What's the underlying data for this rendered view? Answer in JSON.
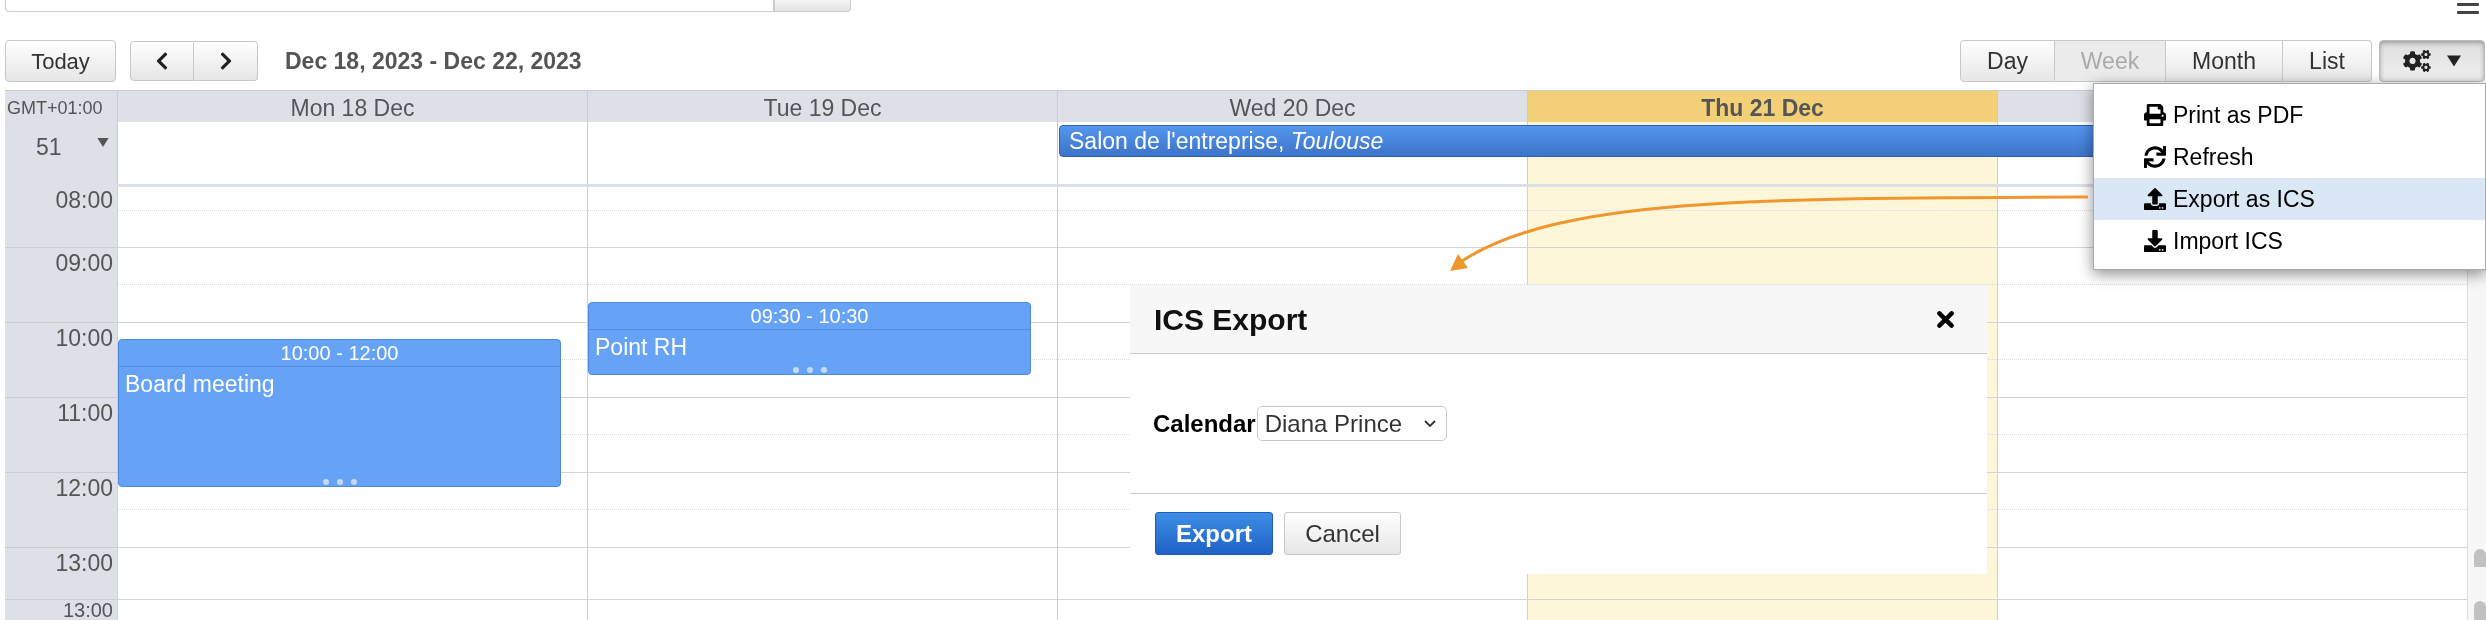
{
  "toolbar": {
    "today_button": "Today",
    "date_range": "Dec 18, 2023 - Dec 22, 2023",
    "views": [
      {
        "label": "Day",
        "selected": false
      },
      {
        "label": "Week",
        "selected": true
      },
      {
        "label": "Month",
        "selected": false
      },
      {
        "label": "List",
        "selected": false
      }
    ]
  },
  "calendar": {
    "timezone": "GMT+01:00",
    "week_number": "51",
    "days": [
      {
        "label": "Mon 18 Dec",
        "today": false,
        "events": [
          {
            "time": "10:00 - 12:00",
            "title": "Board meeting"
          }
        ]
      },
      {
        "label": "Tue 19 Dec",
        "today": false,
        "events": [
          {
            "time": "09:30 - 10:30",
            "title": "Point RH"
          }
        ]
      },
      {
        "label": "Wed 20 Dec",
        "today": false,
        "all_day_events": [
          {
            "title": "Salon de l'entreprise, *Toulouse*"
          }
        ]
      },
      {
        "label": "Thu 21 Dec",
        "today": true
      }
    ],
    "time_slots": [
      "08:00",
      "09:00",
      "10:00",
      "11:00",
      "12:00",
      "13:00",
      "13:00"
    ]
  },
  "menu": {
    "items": [
      {
        "kind": "print",
        "label": "Print as PDF",
        "highlighted": false
      },
      {
        "kind": "refresh",
        "label": "Refresh",
        "highlighted": false
      },
      {
        "kind": "upload",
        "label": "Export as ICS",
        "highlighted": true
      },
      {
        "kind": "download",
        "label": "Import ICS",
        "highlighted": false
      }
    ]
  },
  "dialog": {
    "title": "ICS Export",
    "field_label": "Calendar",
    "field_value": "Diana Prince",
    "buttons": [
      {
        "kind": "primary",
        "label": "Export"
      },
      {
        "kind": "secondary",
        "label": "Cancel"
      }
    ]
  }
}
